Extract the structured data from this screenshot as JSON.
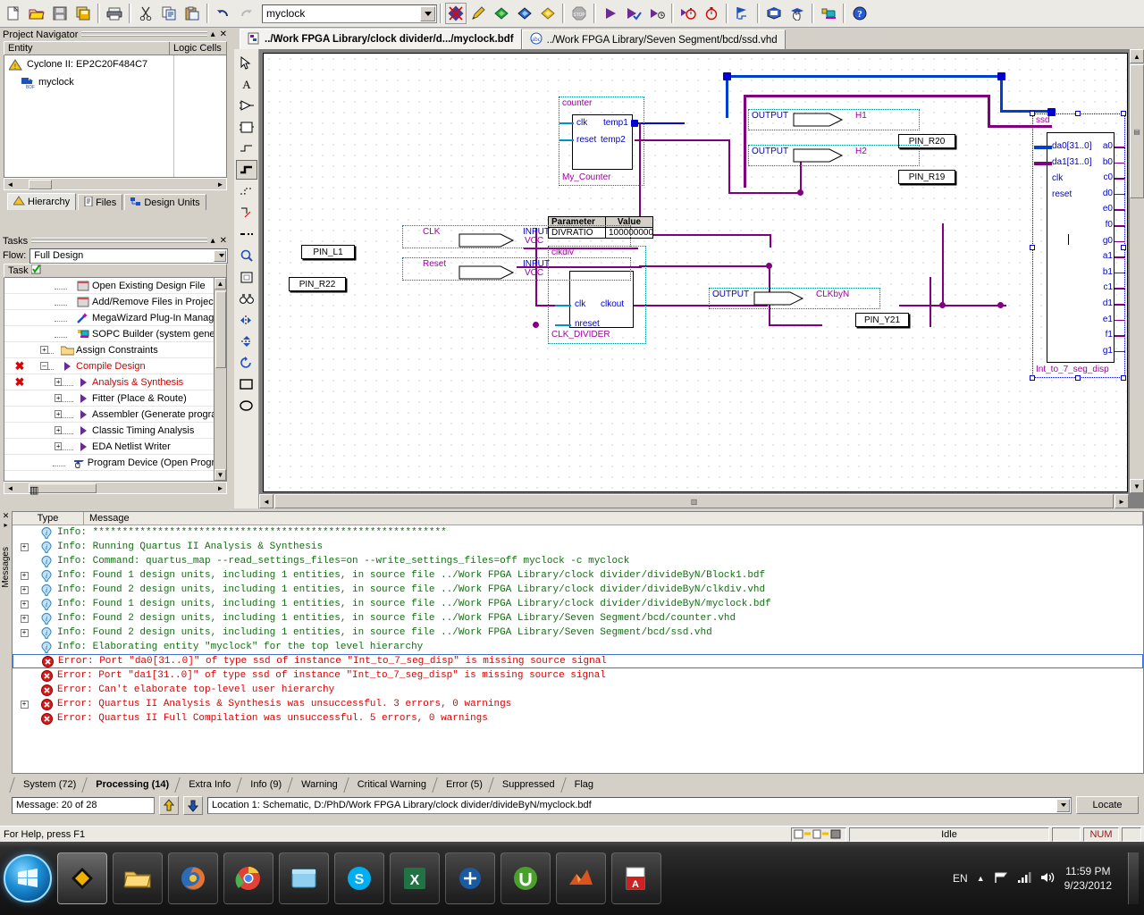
{
  "toolbar": {
    "entity_value": "myclock",
    "buttons": [
      {
        "name": "new-file-button",
        "icon": "new-file-icon"
      },
      {
        "name": "open-file-button",
        "icon": "open-folder-icon"
      },
      {
        "name": "save-button",
        "icon": "save-disk-icon"
      },
      {
        "name": "save-all-button",
        "icon": "save-all-icon"
      },
      {
        "name": "print-button",
        "icon": "printer-icon"
      },
      {
        "name": "cut-button",
        "icon": "scissors-icon"
      },
      {
        "name": "copy-button",
        "icon": "copy-icon"
      },
      {
        "name": "paste-button",
        "icon": "paste-icon"
      },
      {
        "name": "undo-button",
        "icon": "undo-arrow-icon"
      },
      {
        "name": "redo-button",
        "icon": "redo-arrow-icon"
      }
    ],
    "right_buttons": [
      {
        "name": "stop-analysis-button",
        "icon": "cancel-cross-icon"
      },
      {
        "name": "edit-pencil-button",
        "icon": "pencil-icon"
      },
      {
        "name": "analysis-synthesis-button",
        "icon": "green-chip-icon"
      },
      {
        "name": "fitter-button",
        "icon": "blue-chip-icon"
      },
      {
        "name": "assembler-button",
        "icon": "yellow-chip-icon"
      },
      {
        "name": "stop-button",
        "icon": "stop-sign-icon"
      },
      {
        "name": "start-compilation-button",
        "icon": "play-triangle-icon"
      },
      {
        "name": "start-compilation-check-button",
        "icon": "play-check-icon"
      },
      {
        "name": "start-analysis-elaboration-button",
        "icon": "play-clock-icon"
      },
      {
        "name": "timing-analyzer-button",
        "icon": "stopwatch-icon"
      },
      {
        "name": "timing-analyzer-tool-button",
        "icon": "stopwatch-plus-icon"
      },
      {
        "name": "simulation-button",
        "icon": "waveform-flag-icon"
      },
      {
        "name": "assignment-editor-button",
        "icon": "assignment-icon"
      },
      {
        "name": "programmer-button",
        "icon": "hand-program-icon"
      },
      {
        "name": "device-button",
        "icon": "device-chip-icon"
      },
      {
        "name": "help-button",
        "icon": "question-help-icon"
      }
    ]
  },
  "project_navigator": {
    "title": "Project Navigator",
    "columns": [
      "Entity",
      "Logic Cells"
    ],
    "rows": [
      {
        "label": "Cyclone II: EP2C20F484C7",
        "icon": "device-warning-icon",
        "logic_cells": ""
      },
      {
        "label": "myclock",
        "icon": "bdf-file-icon",
        "logic_cells": ""
      }
    ],
    "tabs": [
      {
        "label": "Hierarchy",
        "icon": "hierarchy-icon",
        "active": true
      },
      {
        "label": "Files",
        "icon": "files-icon",
        "active": false
      },
      {
        "label": "Design Units",
        "icon": "design-units-icon",
        "active": false
      }
    ]
  },
  "tasks": {
    "title": "Tasks",
    "flow_label": "Flow:",
    "flow_value": "Full Design",
    "column_header": "Task",
    "items": [
      {
        "label": "Open Existing Design File",
        "icon": "doc-icon",
        "status": "",
        "indent": 1,
        "expandable": false,
        "red": false
      },
      {
        "label": "Add/Remove Files in Project",
        "icon": "doc-icon",
        "status": "",
        "indent": 1,
        "expandable": false,
        "red": false
      },
      {
        "label": "MegaWizard Plug-In Manage",
        "icon": "wizard-icon",
        "status": "",
        "indent": 1,
        "expandable": false,
        "red": false
      },
      {
        "label": "SOPC Builder (system genera",
        "icon": "sopc-icon",
        "status": "",
        "indent": 1,
        "expandable": false,
        "red": false
      },
      {
        "label": "Assign Constraints",
        "icon": "folder-icon",
        "status": "",
        "indent": 0,
        "expandable": true,
        "red": false
      },
      {
        "label": "Compile Design",
        "icon": "play-icon",
        "status": "error",
        "indent": 0,
        "expandable": true,
        "red": true
      },
      {
        "label": "Analysis & Synthesis",
        "icon": "play-icon",
        "status": "error",
        "indent": 1,
        "expandable": true,
        "red": true
      },
      {
        "label": "Fitter (Place & Route)",
        "icon": "play-icon",
        "status": "",
        "indent": 1,
        "expandable": true,
        "red": false
      },
      {
        "label": "Assembler (Generate program",
        "icon": "play-icon",
        "status": "",
        "indent": 1,
        "expandable": true,
        "red": false
      },
      {
        "label": "Classic Timing Analysis",
        "icon": "play-icon",
        "status": "",
        "indent": 1,
        "expandable": true,
        "red": false
      },
      {
        "label": "EDA Netlist Writer",
        "icon": "play-icon",
        "status": "",
        "indent": 1,
        "expandable": true,
        "red": false
      },
      {
        "label": "Program Device (Open Programm",
        "icon": "hand-program-icon",
        "status": "",
        "indent": 1,
        "expandable": false,
        "red": false
      }
    ]
  },
  "editor": {
    "tabs": [
      {
        "label": "../Work FPGA Library/clock divider/d.../myclock.bdf",
        "icon": "bdf-doc-icon",
        "active": true
      },
      {
        "label": "../Work FPGA Library/Seven Segment/bcd/ssd.vhd",
        "icon": "vhdl-doc-icon",
        "active": false
      }
    ],
    "tools": [
      {
        "name": "tool-selection-arrow",
        "icon": "arrow-select-icon"
      },
      {
        "name": "tool-text",
        "icon": "text-a-icon"
      },
      {
        "name": "tool-symbol",
        "icon": "symbol-icon"
      },
      {
        "name": "tool-block",
        "icon": "block-rect-icon"
      },
      {
        "name": "tool-orthogonal-node",
        "icon": "node-line-icon"
      },
      {
        "name": "tool-orthogonal-bus",
        "icon": "bus-line-icon"
      },
      {
        "name": "tool-conduit",
        "icon": "conduit-icon"
      },
      {
        "name": "tool-rubberbanding",
        "icon": "rubberband-icon"
      },
      {
        "name": "tool-partial-line",
        "icon": "partial-line-icon"
      },
      {
        "name": "tool-zoom",
        "icon": "magnifier-icon"
      },
      {
        "name": "tool-fit-in-window",
        "icon": "fit-window-icon"
      },
      {
        "name": "tool-find",
        "icon": "binoculars-icon"
      },
      {
        "name": "tool-flip-horizontal",
        "icon": "flip-h-icon"
      },
      {
        "name": "tool-flip-vertical",
        "icon": "flip-v-icon"
      },
      {
        "name": "tool-rotate",
        "icon": "rotate-icon"
      },
      {
        "name": "tool-rectangle",
        "icon": "rectangle-icon"
      },
      {
        "name": "tool-oval",
        "icon": "oval-icon"
      }
    ],
    "schematic": {
      "blocks": [
        {
          "name": "counter-block",
          "header": "counter",
          "instance": "My_Counter",
          "inputs": [
            "clk",
            "reset"
          ],
          "outputs": [
            "temp1",
            "temp2"
          ]
        },
        {
          "name": "clkdiv-block",
          "header": "clkdiv",
          "instance": "CLK_DIVIDER",
          "inputs": [
            "clk",
            "nreset"
          ],
          "outputs": [
            "clkout"
          ],
          "parameter_table": {
            "headers": [
              "Parameter",
              "Value"
            ],
            "rows": [
              [
                "DIVRATIO",
                "100000000"
              ]
            ]
          }
        },
        {
          "name": "ssd-block",
          "header": "ssd",
          "instance": "Int_to_7_seg_disp",
          "inputs": [
            "da0[31..0]",
            "da1[31..0]",
            "clk",
            "reset"
          ],
          "outputs": [
            "a0",
            "b0",
            "c0",
            "d0",
            "e0",
            "f0",
            "g0",
            "a1",
            "b1",
            "c1",
            "d1",
            "e1",
            "f1",
            "g1"
          ]
        }
      ],
      "input_pins": [
        {
          "net": "CLK",
          "type": "INPUT",
          "default": "VCC",
          "pin": "PIN_L1"
        },
        {
          "net": "Reset",
          "type": "INPUT",
          "default": "VCC",
          "pin": "PIN_R22"
        }
      ],
      "output_pins": [
        {
          "net": "H1",
          "type": "OUTPUT",
          "pin": "PIN_R20"
        },
        {
          "net": "H2",
          "type": "OUTPUT",
          "pin": "PIN_R19"
        },
        {
          "net": "CLKbyN",
          "type": "OUTPUT",
          "pin": "PIN_Y21"
        }
      ]
    }
  },
  "messages": {
    "panel_label": "Messages",
    "columns": [
      "Type",
      "Message"
    ],
    "rows": [
      {
        "type": "info",
        "expandable": false,
        "selected": false,
        "text": "Info: ************************************************************"
      },
      {
        "type": "info",
        "expandable": true,
        "selected": false,
        "text": "Info: Running Quartus II Analysis & Synthesis"
      },
      {
        "type": "info",
        "expandable": false,
        "selected": false,
        "text": "Info: Command: quartus_map --read_settings_files=on --write_settings_files=off myclock -c myclock"
      },
      {
        "type": "info",
        "expandable": true,
        "selected": false,
        "text": "Info: Found 1 design units, including 1 entities, in source file ../Work FPGA Library/clock divider/divideByN/Block1.bdf"
      },
      {
        "type": "info",
        "expandable": true,
        "selected": false,
        "text": "Info: Found 2 design units, including 1 entities, in source file ../Work FPGA Library/clock divider/divideByN/clkdiv.vhd"
      },
      {
        "type": "info",
        "expandable": true,
        "selected": false,
        "text": "Info: Found 1 design units, including 1 entities, in source file ../Work FPGA Library/clock divider/divideByN/myclock.bdf"
      },
      {
        "type": "info",
        "expandable": true,
        "selected": false,
        "text": "Info: Found 2 design units, including 1 entities, in source file ../Work FPGA Library/Seven Segment/bcd/counter.vhd"
      },
      {
        "type": "info",
        "expandable": true,
        "selected": false,
        "text": "Info: Found 2 design units, including 1 entities, in source file ../Work FPGA Library/Seven Segment/bcd/ssd.vhd"
      },
      {
        "type": "info",
        "expandable": false,
        "selected": false,
        "text": "Info: Elaborating entity \"myclock\" for the top level hierarchy"
      },
      {
        "type": "error",
        "expandable": false,
        "selected": true,
        "text": "Error: Port \"da0[31..0]\" of type ssd of instance \"Int_to_7_seg_disp\" is missing source signal"
      },
      {
        "type": "error",
        "expandable": false,
        "selected": false,
        "text": "Error: Port \"da1[31..0]\" of type ssd of instance \"Int_to_7_seg_disp\" is missing source signal"
      },
      {
        "type": "error",
        "expandable": false,
        "selected": false,
        "text": "Error: Can't elaborate top-level user hierarchy"
      },
      {
        "type": "error",
        "expandable": true,
        "selected": false,
        "text": "Error: Quartus II Analysis & Synthesis was unsuccessful. 3 errors, 0 warnings"
      },
      {
        "type": "error",
        "expandable": false,
        "selected": false,
        "text": "Error: Quartus II Full Compilation was unsuccessful. 5 errors, 0 warnings"
      }
    ],
    "tabs": [
      {
        "label": "System (72)",
        "active": false
      },
      {
        "label": "Processing (14)",
        "active": true
      },
      {
        "label": "Extra Info",
        "active": false
      },
      {
        "label": "Info (9)",
        "active": false
      },
      {
        "label": "Warning",
        "active": false
      },
      {
        "label": "Critical Warning",
        "active": false
      },
      {
        "label": "Error (5)",
        "active": false
      },
      {
        "label": "Suppressed",
        "active": false
      },
      {
        "label": "Flag",
        "active": false
      }
    ],
    "message_counter": "Message: 20 of 28",
    "location": "Location 1: Schematic, D:/PhD/Work FPGA Library/clock divider/divideByN/myclock.bdf",
    "locate_button": "Locate"
  },
  "status_bar": {
    "help_text": "For Help, press F1",
    "process_status": "Idle",
    "num_lock": "NUM"
  },
  "taskbar": {
    "items": [
      {
        "name": "taskbar-quartus",
        "icon": "quartus-icon"
      },
      {
        "name": "taskbar-explorer",
        "icon": "folder-explorer-icon"
      },
      {
        "name": "taskbar-firefox",
        "icon": "firefox-icon"
      },
      {
        "name": "taskbar-chrome",
        "icon": "chrome-icon"
      },
      {
        "name": "taskbar-window",
        "icon": "window-icon"
      },
      {
        "name": "taskbar-skype",
        "icon": "skype-icon"
      },
      {
        "name": "taskbar-excel",
        "icon": "excel-icon"
      },
      {
        "name": "taskbar-quartus2",
        "icon": "quartus-blue-icon"
      },
      {
        "name": "taskbar-utorrent",
        "icon": "utorrent-icon"
      },
      {
        "name": "taskbar-matlab",
        "icon": "matlab-icon"
      },
      {
        "name": "taskbar-acrobat",
        "icon": "acrobat-icon"
      }
    ],
    "tray": {
      "language": "EN",
      "time": "11:59 PM",
      "date": "9/23/2012"
    }
  }
}
